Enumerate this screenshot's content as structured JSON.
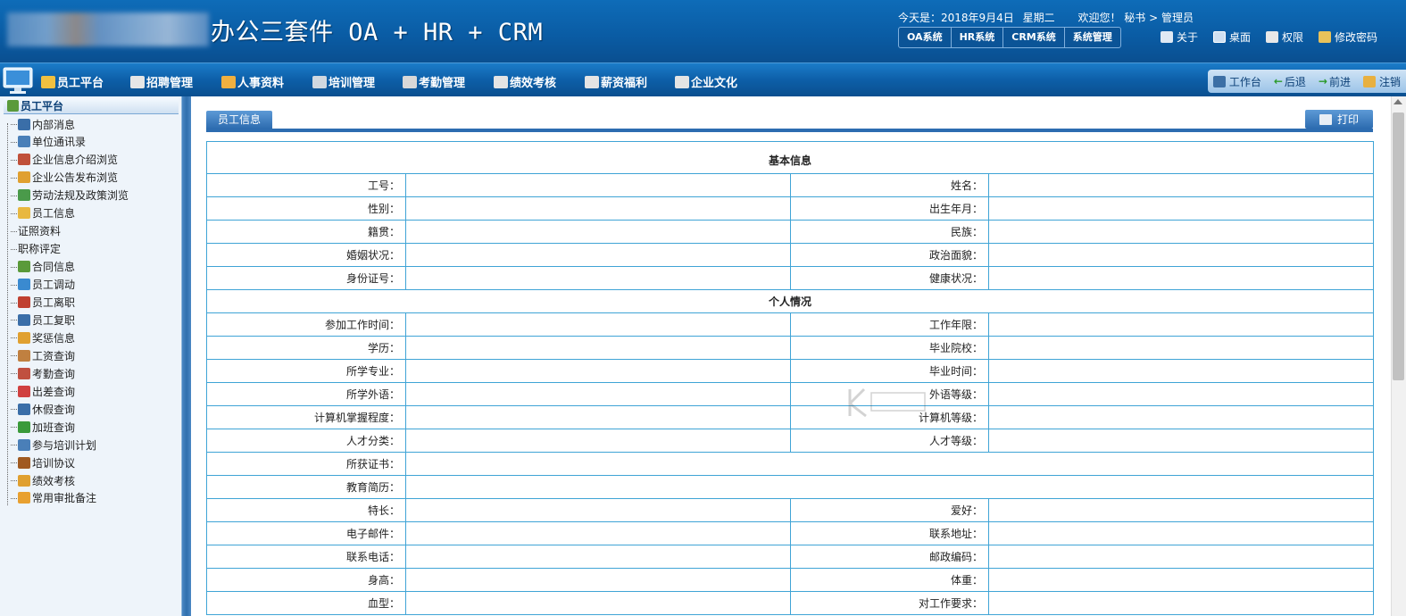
{
  "header": {
    "app_title": "办公三套件 OA + HR + CRM",
    "date_text": "今天是：2018年9月4日",
    "weekday": "星期二",
    "welcome": "欢迎您！ 秘书 > 管理员",
    "system_tabs": [
      "OA系统",
      "HR系统",
      "CRM系统",
      "系统管理"
    ],
    "links": [
      {
        "label": "关于",
        "icon": "about-icon"
      },
      {
        "label": "桌面",
        "icon": "desktop-icon"
      },
      {
        "label": "权限",
        "icon": "permission-icon"
      },
      {
        "label": "修改密码",
        "icon": "key-icon"
      }
    ]
  },
  "nav": {
    "items": [
      {
        "label": "员工平台",
        "icon": "employee-platform-icon"
      },
      {
        "label": "招聘管理",
        "icon": "recruit-icon"
      },
      {
        "label": "人事资料",
        "icon": "personnel-icon"
      },
      {
        "label": "培训管理",
        "icon": "training-icon"
      },
      {
        "label": "考勤管理",
        "icon": "attendance-icon"
      },
      {
        "label": "绩效考核",
        "icon": "performance-icon"
      },
      {
        "label": "薪资福利",
        "icon": "salary-icon"
      },
      {
        "label": "企业文化",
        "icon": "culture-icon"
      }
    ],
    "right": [
      {
        "label": "工作台",
        "icon": "workbench-icon"
      },
      {
        "label": "后退",
        "icon": "back-arrow-icon"
      },
      {
        "label": "前进",
        "icon": "forward-arrow-icon"
      },
      {
        "label": "注销",
        "icon": "logout-icon"
      }
    ]
  },
  "sidebar": {
    "title": "员工平台",
    "items": [
      {
        "label": "内部消息",
        "icon": "message-icon"
      },
      {
        "label": "单位通讯录",
        "icon": "addressbook-icon"
      },
      {
        "label": "企业信息介绍浏览",
        "icon": "edit-icon"
      },
      {
        "label": "企业公告发布浏览",
        "icon": "notice-icon"
      },
      {
        "label": "劳动法规及政策浏览",
        "icon": "law-icon"
      },
      {
        "label": "员工信息",
        "icon": "folder-user-icon"
      },
      {
        "label": "证照资料",
        "icon": ""
      },
      {
        "label": "职称评定",
        "icon": ""
      },
      {
        "label": "合同信息",
        "icon": "contract-icon"
      },
      {
        "label": "员工调动",
        "icon": "transfer-icon"
      },
      {
        "label": "员工离职",
        "icon": "resign-icon"
      },
      {
        "label": "员工复职",
        "icon": "reinstate-icon"
      },
      {
        "label": "奖惩信息",
        "icon": "award-icon"
      },
      {
        "label": "工资查询",
        "icon": "book-icon"
      },
      {
        "label": "考勤查询",
        "icon": "attendance-query-icon"
      },
      {
        "label": "出差查询",
        "icon": "trip-icon"
      },
      {
        "label": "休假查询",
        "icon": "leave-icon"
      },
      {
        "label": "加班查询",
        "icon": "overtime-icon"
      },
      {
        "label": "参与培训计划",
        "icon": "train-plan-icon"
      },
      {
        "label": "培训协议",
        "icon": "agreement-icon"
      },
      {
        "label": "绩效考核",
        "icon": "assess-icon"
      },
      {
        "label": "常用审批备注",
        "icon": "approval-icon"
      }
    ]
  },
  "panel": {
    "tab": "员工信息",
    "print": "打印"
  },
  "form": {
    "section_basic": "基本信息",
    "section_personal": "个人情况",
    "basic_rows": [
      [
        "工号：",
        "姓名："
      ],
      [
        "性别：",
        "出生年月："
      ],
      [
        "籍贯：",
        "民族："
      ],
      [
        "婚姻状况：",
        "政治面貌："
      ],
      [
        "身份证号：",
        "健康状况："
      ]
    ],
    "personal_rows": [
      [
        "参加工作时间：",
        "工作年限："
      ],
      [
        "学历：",
        "毕业院校："
      ],
      [
        "所学专业：",
        "毕业时间："
      ],
      [
        "所学外语：",
        "外语等级："
      ],
      [
        "计算机掌握程度：",
        "计算机等级："
      ],
      [
        "人才分类：",
        "人才等级："
      ]
    ],
    "full_rows": [
      "所获证书：",
      "教育简历："
    ],
    "tail_rows": [
      [
        "特长：",
        "爱好："
      ],
      [
        "电子邮件：",
        "联系地址："
      ],
      [
        "联系电话：",
        "邮政编码："
      ],
      [
        "身高：",
        "体重："
      ],
      [
        "血型：",
        "对工作要求："
      ]
    ]
  },
  "colors": {
    "header_blue": "#0a5ba3",
    "border_cyan": "#3fa4d6",
    "sidebar_bg": "#eef4fa"
  }
}
